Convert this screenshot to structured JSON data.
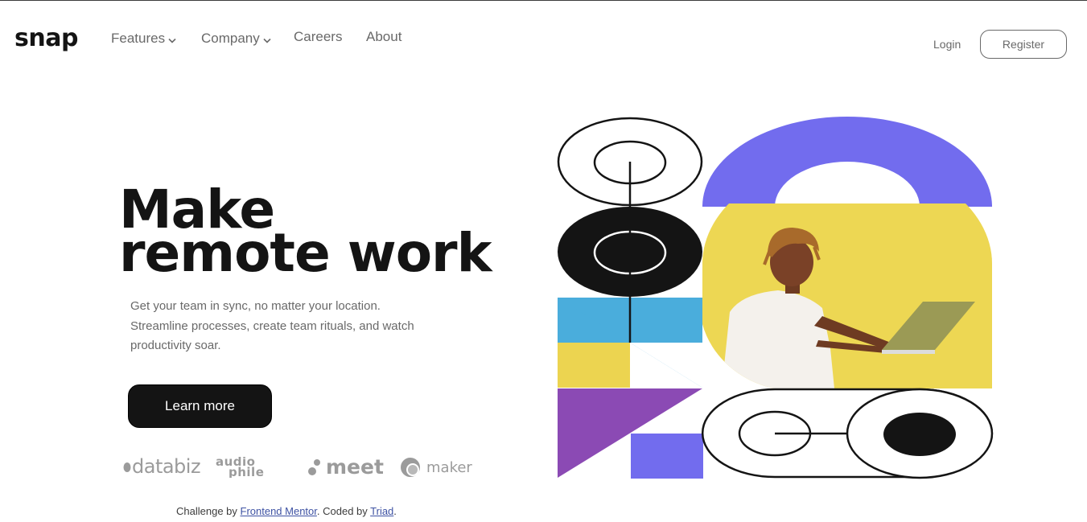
{
  "header": {
    "logo": "snap",
    "nav": [
      {
        "label": "Features",
        "has_dropdown": true
      },
      {
        "label": "Company",
        "has_dropdown": true
      },
      {
        "label": "Careers",
        "has_dropdown": false
      },
      {
        "label": "About",
        "has_dropdown": false
      }
    ],
    "login_label": "Login",
    "register_label": "Register"
  },
  "hero": {
    "title_line1": "Make",
    "title_line2": "remote work",
    "description": "Get your team in sync, no matter your location. Streamline processes, create team rituals, and watch productivity soar.",
    "cta_label": "Learn more"
  },
  "clients": [
    {
      "name": "databiz",
      "icon": "databiz-logo"
    },
    {
      "name": "audiophile",
      "icon": "audiophile-logo"
    },
    {
      "name": "meet",
      "icon": "meet-logo"
    },
    {
      "name": "maker",
      "icon": "maker-logo"
    }
  ],
  "footer": {
    "prefix": "Challenge by ",
    "link1": "Frontend Mentor",
    "middle": ". Coded by ",
    "link2": "Triad",
    "suffix": "."
  },
  "colors": {
    "ink": "#141414",
    "gray": "#696969",
    "purple": "#726cee",
    "yellow": "#ecd450",
    "blue": "#4aaddc",
    "violet": "#8b4ab4"
  }
}
